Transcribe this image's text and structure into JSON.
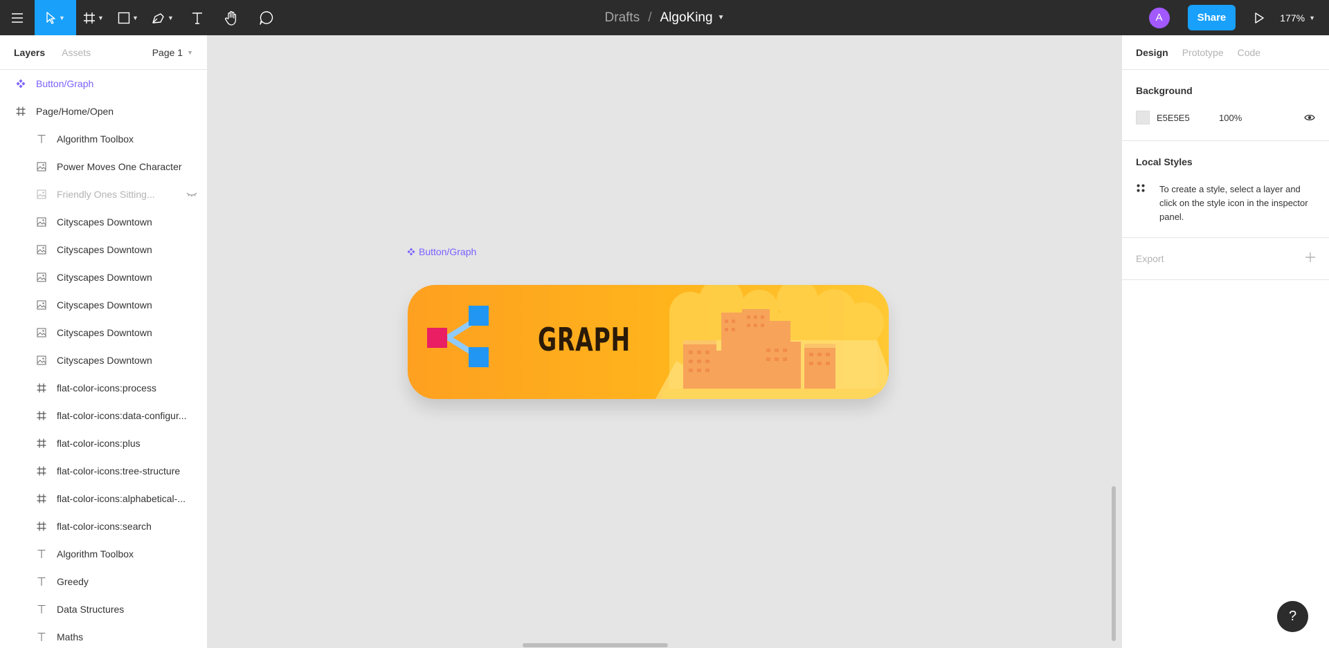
{
  "toolbar": {
    "breadcrumb_drafts": "Drafts",
    "breadcrumb_sep": "/",
    "file_name": "AlgoKing",
    "avatar_initial": "A",
    "share_label": "Share",
    "zoom": "177%",
    "tools": [
      "menu-icon",
      "move-tool-icon",
      "frame-tool-icon",
      "shape-tool-icon",
      "pen-tool-icon",
      "text-tool-icon",
      "hand-tool-icon",
      "comment-tool-icon"
    ]
  },
  "left_panel": {
    "tab_layers": "Layers",
    "tab_assets": "Assets",
    "page": "Page 1",
    "layers": [
      {
        "name": "Button/Graph",
        "type": "component",
        "level": "top"
      },
      {
        "name": "Page/Home/Open",
        "type": "frame",
        "level": "top"
      },
      {
        "name": "Algorithm Toolbox",
        "type": "text",
        "level": "child"
      },
      {
        "name": "Power Moves One Character",
        "type": "image",
        "level": "child"
      },
      {
        "name": "Friendly Ones Sitting...",
        "type": "image",
        "level": "child",
        "hidden": true
      },
      {
        "name": "Cityscapes Downtown",
        "type": "image",
        "level": "child"
      },
      {
        "name": "Cityscapes Downtown",
        "type": "image",
        "level": "child"
      },
      {
        "name": "Cityscapes Downtown",
        "type": "image",
        "level": "child"
      },
      {
        "name": "Cityscapes Downtown",
        "type": "image",
        "level": "child"
      },
      {
        "name": "Cityscapes Downtown",
        "type": "image",
        "level": "child"
      },
      {
        "name": "Cityscapes Downtown",
        "type": "image",
        "level": "child"
      },
      {
        "name": "flat-color-icons:process",
        "type": "frame",
        "level": "child"
      },
      {
        "name": "flat-color-icons:data-configur...",
        "type": "frame",
        "level": "child"
      },
      {
        "name": "flat-color-icons:plus",
        "type": "frame",
        "level": "child"
      },
      {
        "name": "flat-color-icons:tree-structure",
        "type": "frame",
        "level": "child"
      },
      {
        "name": "flat-color-icons:alphabetical-...",
        "type": "frame",
        "level": "child"
      },
      {
        "name": "flat-color-icons:search",
        "type": "frame",
        "level": "child"
      },
      {
        "name": "Algorithm Toolbox",
        "type": "text",
        "level": "child"
      },
      {
        "name": "Greedy",
        "type": "text",
        "level": "child"
      },
      {
        "name": "Data Structures",
        "type": "text",
        "level": "child"
      },
      {
        "name": "Maths",
        "type": "text",
        "level": "child"
      }
    ]
  },
  "canvas": {
    "frame_label": "Button/Graph",
    "button_text": "GRAPH"
  },
  "right_panel": {
    "tabs": [
      "Design",
      "Prototype",
      "Code"
    ],
    "background_heading": "Background",
    "background_hex": "E5E5E5",
    "background_opacity": "100%",
    "local_styles_heading": "Local Styles",
    "local_styles_text": "To create a style, select a layer and click on the style icon in the inspector panel.",
    "export_heading": "Export",
    "help": "?"
  },
  "colors": {
    "accent": "#18a0fb",
    "component": "#7b61ff",
    "toolbar_bg": "#2c2c2c",
    "canvas_bg": "#e5e5e5"
  }
}
